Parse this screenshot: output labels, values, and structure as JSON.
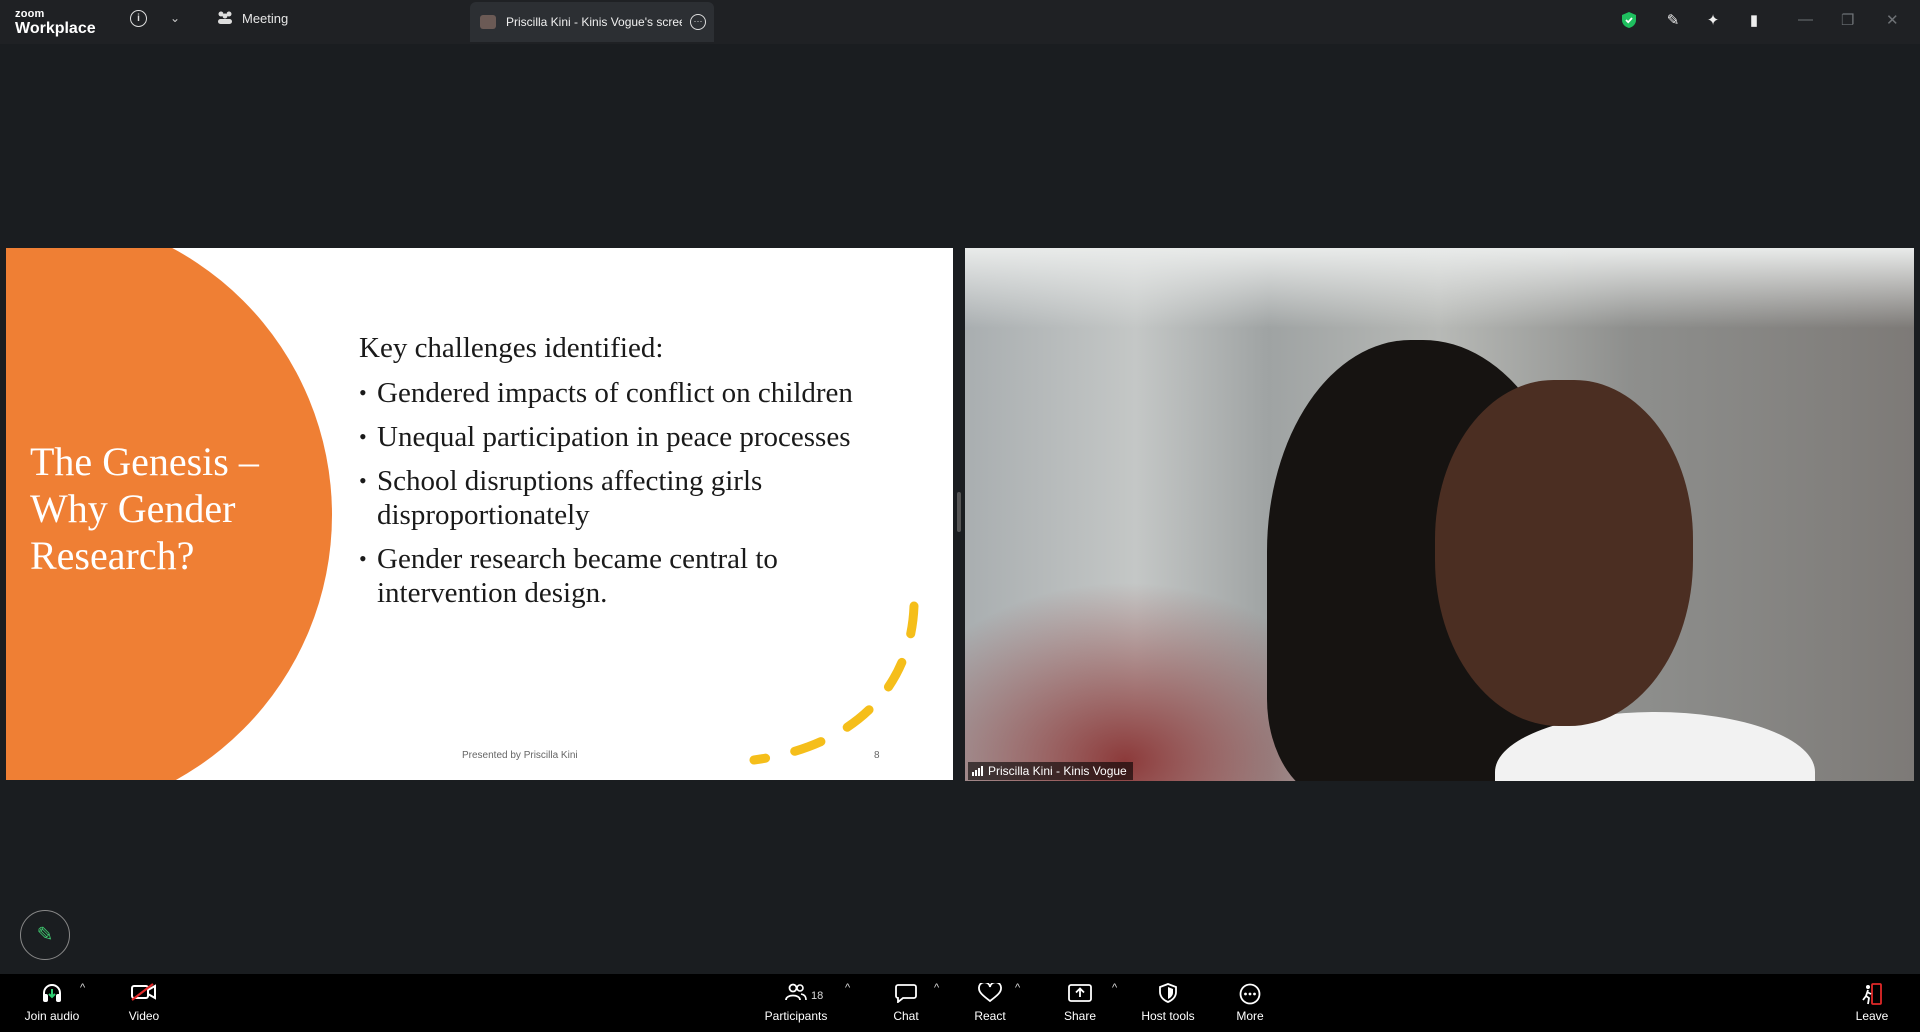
{
  "app": {
    "logo_small": "zoom",
    "logo_big": "Workplace"
  },
  "tabs": {
    "meeting": {
      "label": "Meeting"
    },
    "share": {
      "label": "Priscilla Kini - Kinis Vogue's screen"
    }
  },
  "slide": {
    "title": "The Genesis – Why Gender Research?",
    "heading": "Key challenges identified:",
    "bullets": [
      "Gendered impacts of  conflict on children",
      "Unequal participation in peace processes",
      "School disruptions affecting girls disproportionately",
      "Gender research became central to intervention design."
    ],
    "footer": "Presented by Priscilla Kini",
    "page_number": "8",
    "accent_color": "#ef7f34",
    "dash_color": "#f5be1a"
  },
  "video": {
    "participant_name": "Priscilla Kini - Kinis Vogue"
  },
  "toolbar": {
    "join_audio": "Join audio",
    "video": "Video",
    "participants": "Participants",
    "participants_count": "18",
    "chat": "Chat",
    "react": "React",
    "share": "Share",
    "host_tools": "Host tools",
    "more": "More",
    "leave": "Leave"
  },
  "icons": [
    "info-icon",
    "chevron-down-icon",
    "meeting-icon",
    "more-icon",
    "shield-icon",
    "sparkle-icon",
    "pen-icon",
    "exit-icon",
    "minimize-icon",
    "restore-icon",
    "close-icon",
    "annotate-pencil-icon",
    "headphones-icon",
    "video-off-icon",
    "participants-icon",
    "chat-icon",
    "react-heart-icon",
    "share-icon",
    "host-tools-icon",
    "more-circle-icon",
    "leave-icon"
  ]
}
